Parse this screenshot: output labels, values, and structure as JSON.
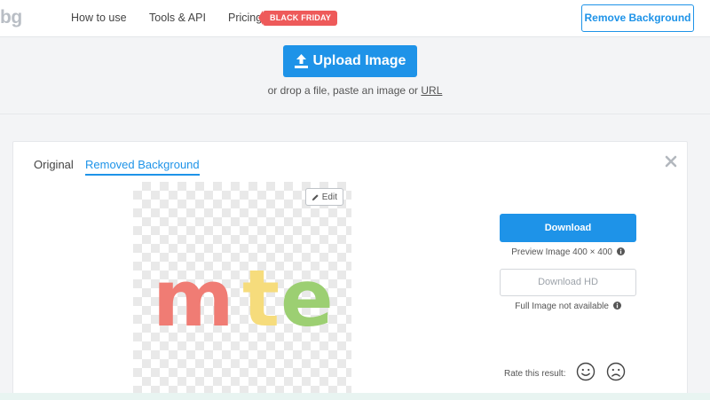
{
  "header": {
    "logo_text": "bg",
    "nav": {
      "how_to_use": "How to use",
      "tools_api": "Tools & API",
      "pricing": "Pricing",
      "black_friday_badge": "BLACK FRIDAY"
    },
    "remove_background_button": "Remove Background"
  },
  "upload": {
    "button_label": "Upload Image",
    "drop_text": "or drop a file, paste an image or ",
    "url_link": "URL",
    "icon": "upload-icon"
  },
  "result": {
    "tabs": [
      {
        "label": "Original",
        "active": false
      },
      {
        "label": "Removed Background",
        "active": true
      }
    ],
    "close_icon": "close-icon",
    "edit_button": "Edit",
    "preview_letters": [
      {
        "char": "m",
        "color": "#f07c74"
      },
      {
        "char": "t",
        "color": "#f6dc7c"
      },
      {
        "char": "e",
        "color": "#9ccf72"
      }
    ],
    "download_button": "Download",
    "preview_size": "Preview Image 400 × 400",
    "download_hd_button": "Download HD",
    "full_image_note": "Full Image not available",
    "rate_label": "Rate this result:",
    "rate_icons": [
      "smile-icon",
      "frown-icon"
    ]
  },
  "colors": {
    "accent": "#1e93e8",
    "badge": "#ee5a5a"
  }
}
